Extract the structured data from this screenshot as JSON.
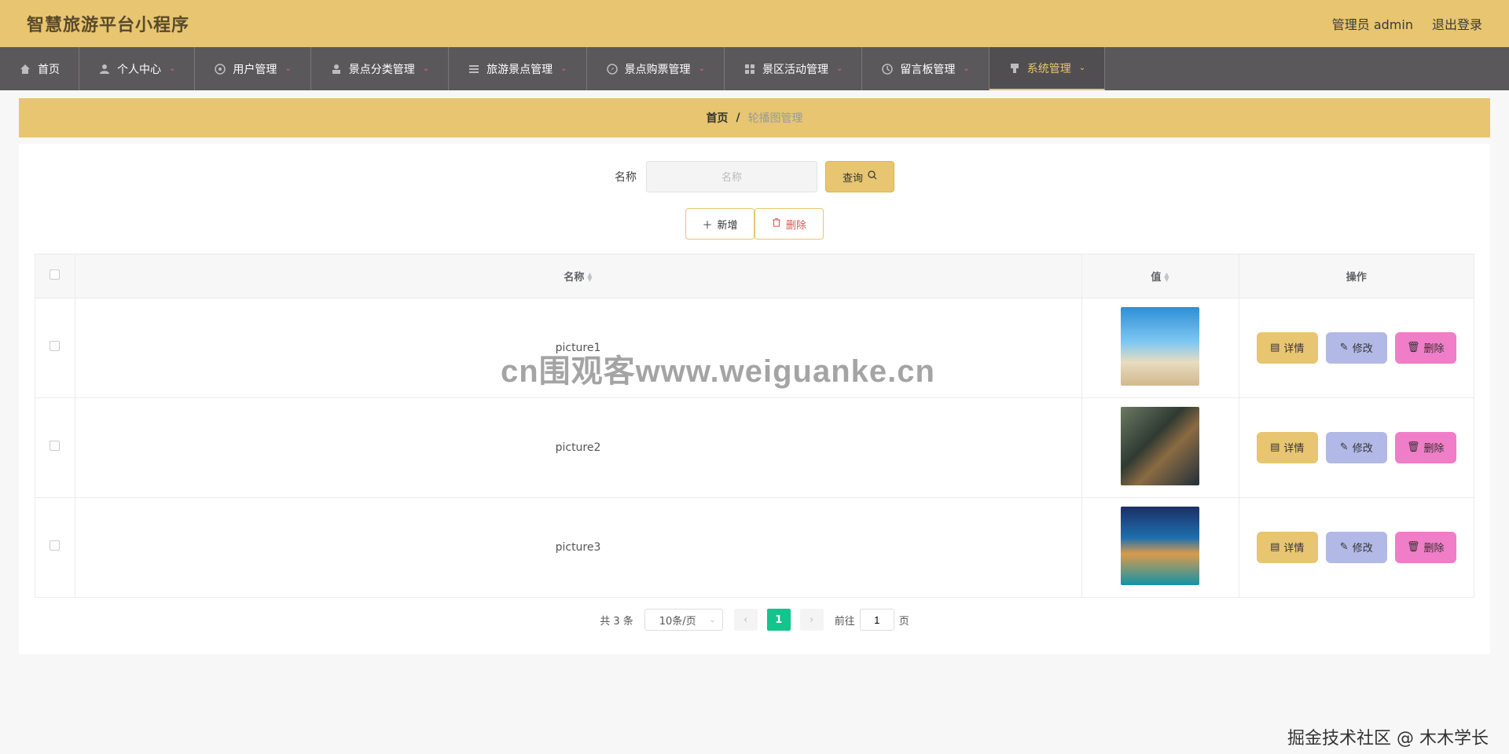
{
  "header": {
    "app_title": "智慧旅游平台小程序",
    "user_label": "管理员 admin",
    "logout_label": "退出登录"
  },
  "nav": {
    "items": [
      {
        "label": "首页",
        "icon": "home-icon"
      },
      {
        "label": "个人中心",
        "icon": "user-icon"
      },
      {
        "label": "用户管理",
        "icon": "users-icon"
      },
      {
        "label": "景点分类管理",
        "icon": "person-icon"
      },
      {
        "label": "旅游景点管理",
        "icon": "list-icon"
      },
      {
        "label": "景点购票管理",
        "icon": "compass-icon"
      },
      {
        "label": "景区活动管理",
        "icon": "grid-icon"
      },
      {
        "label": "留言板管理",
        "icon": "clock-icon"
      },
      {
        "label": "系统管理",
        "icon": "cup-icon"
      }
    ],
    "active_index": 8
  },
  "breadcrumb": {
    "home": "首页",
    "separator": "/",
    "current": "轮播图管理"
  },
  "search": {
    "label": "名称",
    "placeholder": "名称",
    "button_label": "查询"
  },
  "actions": {
    "add_label": "新增",
    "delete_label": "删除"
  },
  "table": {
    "columns": [
      "名称",
      "值",
      "操作"
    ],
    "rows": [
      {
        "name": "picture1",
        "thumb": "beach"
      },
      {
        "name": "picture2",
        "thumb": "canal"
      },
      {
        "name": "picture3",
        "thumb": "pool"
      }
    ],
    "row_buttons": {
      "detail": "详情",
      "edit": "修改",
      "delete": "删除"
    }
  },
  "pagination": {
    "total_text": "共 3 条",
    "page_size": "10条/页",
    "current_page": "1",
    "goto_prefix": "前往",
    "goto_value": "1",
    "goto_suffix": "页"
  },
  "overlay": {
    "watermark": "cn围观客www.weiguanke.cn",
    "credit": "掘金技术社区 @ 木木学长"
  },
  "colors": {
    "accent": "#e7c571",
    "nav_bg": "#5b585b",
    "page_active": "#13c48b",
    "edit_btn": "#b2b9e6",
    "delete_btn": "#f07dc7"
  }
}
